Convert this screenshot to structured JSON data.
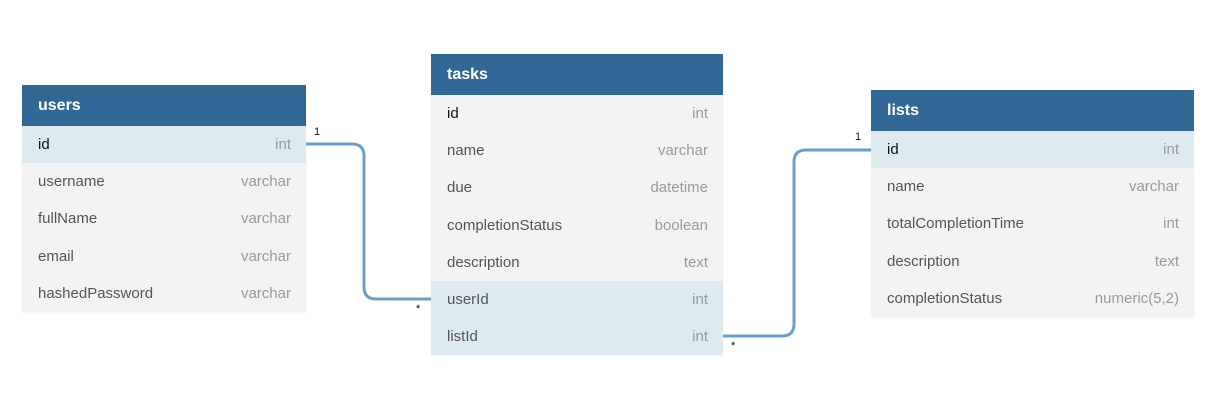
{
  "tables": {
    "users": {
      "title": "users",
      "fields": [
        {
          "name": "id",
          "type": "int"
        },
        {
          "name": "username",
          "type": "varchar"
        },
        {
          "name": "fullName",
          "type": "varchar"
        },
        {
          "name": "email",
          "type": "varchar"
        },
        {
          "name": "hashedPassword",
          "type": "varchar"
        }
      ]
    },
    "tasks": {
      "title": "tasks",
      "fields": [
        {
          "name": "id",
          "type": "int"
        },
        {
          "name": "name",
          "type": "varchar"
        },
        {
          "name": "due",
          "type": "datetime"
        },
        {
          "name": "completionStatus",
          "type": "boolean"
        },
        {
          "name": "description",
          "type": "text"
        },
        {
          "name": "userId",
          "type": "int"
        },
        {
          "name": "listId",
          "type": "int"
        }
      ]
    },
    "lists": {
      "title": "lists",
      "fields": [
        {
          "name": "id",
          "type": "int"
        },
        {
          "name": "name",
          "type": "varchar"
        },
        {
          "name": "totalCompletionTime",
          "type": "int"
        },
        {
          "name": "description",
          "type": "text"
        },
        {
          "name": "completionStatus",
          "type": "numeric(5,2)"
        }
      ]
    }
  },
  "relationships": [
    {
      "from": "users.id",
      "to": "tasks.userId",
      "from_card": "1",
      "to_card": "*"
    },
    {
      "from": "lists.id",
      "to": "tasks.listId",
      "from_card": "1",
      "to_card": "*"
    }
  ],
  "colors": {
    "header_bg": "#316896",
    "connector": "#6a9fcb",
    "row_highlight": "#ddebf1",
    "table_bg": "#f3f3f3"
  }
}
